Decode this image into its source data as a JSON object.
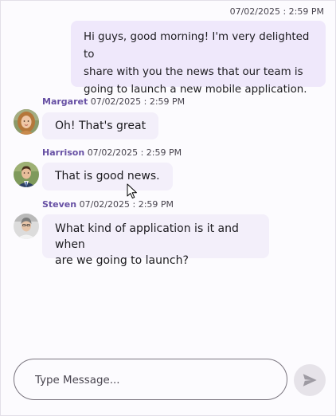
{
  "outgoing": {
    "timestamp": "07/02/2025 : 2:59 PM",
    "line1": "Hi guys, good morning! I'm very delighted to",
    "line2": "share with you the news that our team is",
    "line3": "going to launch a new mobile application."
  },
  "messages": [
    {
      "author": "Margaret",
      "timestamp": "07/02/2025 : 2:59 PM",
      "text": "Oh! That's great"
    },
    {
      "author": "Harrison",
      "timestamp": "07/02/2025 : 2:59 PM",
      "text": "That is good news."
    },
    {
      "author": "Steven",
      "timestamp": "07/02/2025 : 2:59 PM",
      "line1": "What kind of application is it and when",
      "line2": "are we going to launch?"
    }
  ],
  "composer": {
    "placeholder": "Type Message...",
    "value": ""
  },
  "icons": {
    "send": "send-icon",
    "cursor": "mouse-pointer-icon"
  },
  "colors": {
    "accent": "#6750a4",
    "outgoing_bubble": "#efe8fb",
    "incoming_bubble": "#f3effa",
    "send_button": "#e6e3e9"
  }
}
